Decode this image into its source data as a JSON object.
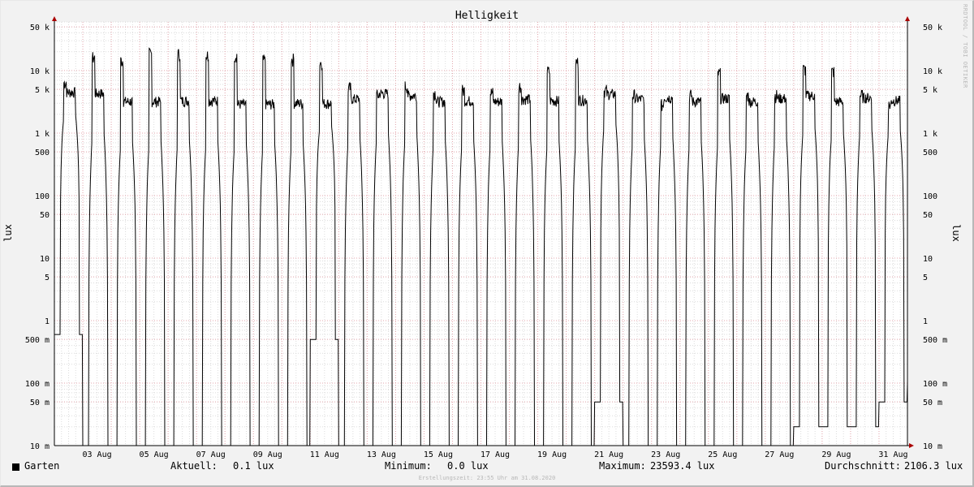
{
  "chart_data": {
    "type": "line",
    "title": "Helligkeit",
    "ylabel": "lux",
    "yscale": "log",
    "ylim": [
      0.01,
      60000
    ],
    "y_ticks": [
      {
        "value": 0.01,
        "label": "10 m"
      },
      {
        "value": 0.05,
        "label": "50 m"
      },
      {
        "value": 0.1,
        "label": "100 m"
      },
      {
        "value": 0.5,
        "label": "500 m"
      },
      {
        "value": 1,
        "label": "1"
      },
      {
        "value": 5,
        "label": "5"
      },
      {
        "value": 10,
        "label": "10"
      },
      {
        "value": 50,
        "label": "50"
      },
      {
        "value": 100,
        "label": "100"
      },
      {
        "value": 500,
        "label": "500"
      },
      {
        "value": 1000,
        "label": "1 k"
      },
      {
        "value": 5000,
        "label": "5 k"
      },
      {
        "value": 10000,
        "label": "10 k"
      },
      {
        "value": 50000,
        "label": "50 k"
      }
    ],
    "x_ticks": [
      "03 Aug",
      "05 Aug",
      "07 Aug",
      "09 Aug",
      "11 Aug",
      "13 Aug",
      "15 Aug",
      "17 Aug",
      "19 Aug",
      "21 Aug",
      "23 Aug",
      "25 Aug",
      "27 Aug",
      "29 Aug",
      "31 Aug"
    ],
    "grid": true,
    "series": [
      {
        "name": "Garten",
        "color": "#000000",
        "daily_peak_lux": [
          8000,
          20000,
          18000,
          23000,
          23000,
          22000,
          22000,
          18000,
          19000,
          17000,
          6500,
          5000,
          7000,
          5500,
          6000,
          5500,
          7000,
          12000,
          17000,
          6000,
          5000,
          3500,
          5000,
          11000,
          5000,
          5000,
          13000,
          12000,
          5000,
          3500
        ],
        "daily_plateau_lux": [
          4500,
          4300,
          3200,
          3200,
          3300,
          3300,
          2900,
          2900,
          3000,
          3000,
          3500,
          4300,
          4000,
          3200,
          3300,
          3200,
          3500,
          3300,
          3400,
          4200,
          3500,
          3700,
          3200,
          3600,
          3200,
          3600,
          4000,
          3200,
          3700,
          3300
        ],
        "daily_min_lux": [
          0.6,
          0,
          0,
          0,
          0,
          0,
          0,
          0,
          0,
          0.5,
          0,
          0,
          0,
          0,
          0,
          0,
          0,
          0,
          0,
          0.05,
          0,
          0,
          0,
          0,
          0,
          0,
          0.02,
          0.02,
          0.02,
          0.05
        ]
      }
    ]
  },
  "legend": {
    "series_name": "Garten",
    "current_label": "Aktuell:",
    "current_value": "0.1 lux",
    "min_label": "Minimum:",
    "min_value": "0.0 lux",
    "max_label": "Maximum:",
    "max_value": "23593.4 lux",
    "avg_label": "Durchschnitt:",
    "avg_value": "2106.3 lux"
  },
  "footer": "Erstellungszeit: 23:55 Uhr am 31.08.2020",
  "watermark": "RRDTOOL / TOBI OETIKER"
}
